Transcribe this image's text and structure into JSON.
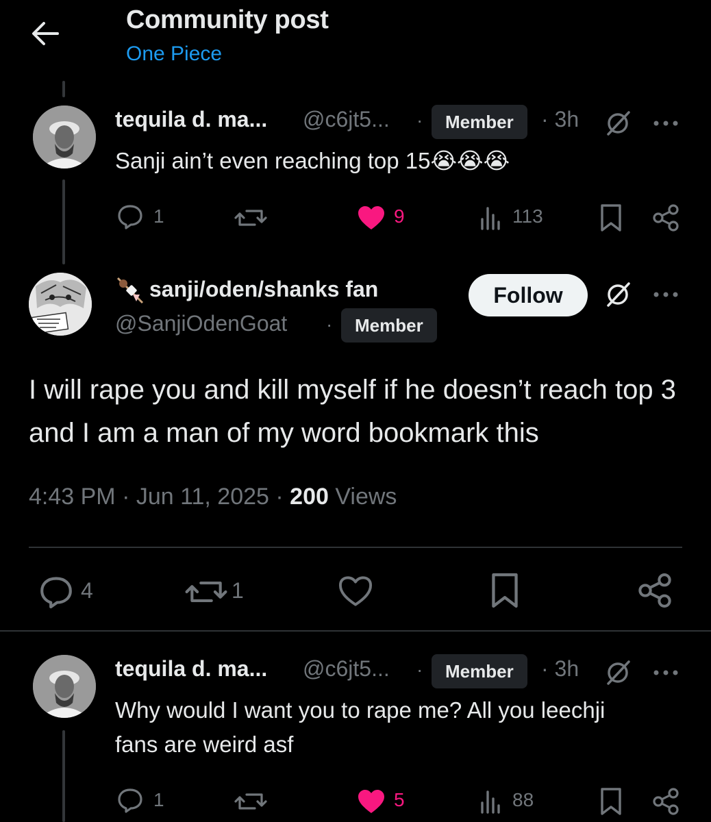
{
  "header": {
    "title": "Community post",
    "community": "One Piece"
  },
  "reply1": {
    "name": "tequila d. ma...",
    "handle": "@c6jt5...",
    "badge": "Member",
    "time": "3h",
    "text": "Sanji ain’t even reaching top 15😭😭😭",
    "replies": "1",
    "likes": "9",
    "views": "113"
  },
  "main": {
    "name": "sanji/oden/shanks fan",
    "handle": "@SanjiOdenGoat",
    "badge": "Member",
    "follow_label": "Follow",
    "text": "I will rape you and kill myself if he doesn’t reach top 3 and I am a man of my word bookmark this",
    "time": "4:43 PM",
    "date": "Jun 11, 2025",
    "views_count": "200",
    "views_label": "Views",
    "replies": "4",
    "reposts": "1"
  },
  "reply2": {
    "name": "tequila d. ma...",
    "handle": "@c6jt5...",
    "badge": "Member",
    "time": "3h",
    "text": "Why would I want you to rape me? All you leechji fans are weird asf",
    "replies": "1",
    "likes": "5",
    "views": "88"
  },
  "icons": {
    "back": "arrow-left-icon",
    "reply": "speech-bubble-icon",
    "repost": "repost-arrows-icon",
    "like": "heart-icon",
    "views": "bar-chart-icon",
    "bookmark": "bookmark-icon",
    "share": "share-nodes-icon",
    "grok": "slashed-circle-icon",
    "more": "ellipsis-icon"
  },
  "colors": {
    "background": "#000000",
    "accent": "#1d9bf0",
    "like": "#f91880",
    "muted": "#71767b",
    "text": "#e7e9ea"
  }
}
